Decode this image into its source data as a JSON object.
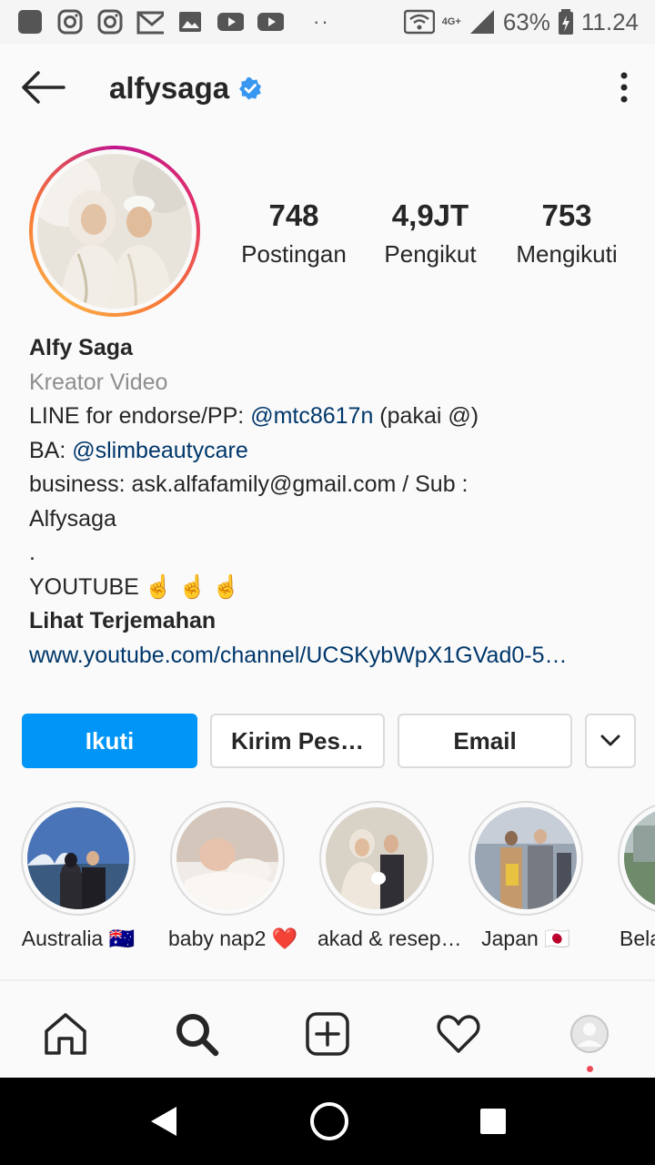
{
  "status_bar": {
    "network": "4G+",
    "battery": "63%",
    "time": "11.24",
    "dots": "··",
    "notification_icons": [
      "square-icon",
      "instagram-icon",
      "instagram-icon",
      "gmail-icon",
      "image-icon",
      "youtube-icon",
      "youtube-icon"
    ]
  },
  "header": {
    "username": "alfysaga",
    "verified": true
  },
  "profile": {
    "stats": [
      {
        "value": "748",
        "label": "Postingan"
      },
      {
        "value": "4,9JT",
        "label": "Pengikut"
      },
      {
        "value": "753",
        "label": "Mengikuti"
      }
    ],
    "name": "Alfy Saga",
    "category": "Kreator Video",
    "bio": {
      "line1_prefix": "LINE for endorse/PP: ",
      "line1_mention": "@mtc8617n",
      "line1_suffix": " (pakai @)",
      "line2_prefix": "BA: ",
      "line2_mention": "@slimbeautycare",
      "line3": "business: ask.alfafamily@gmail.com / Sub :",
      "line4": "Alfysaga",
      "line5": ".",
      "line6": "YOUTUBE",
      "line6_emoji": "☝☝☝",
      "translate": "Lihat Terjemahan",
      "link": "www.youtube.com/channel/UCSKybWpX1GVad0-5…"
    }
  },
  "actions": {
    "follow": "Ikuti",
    "message": "Kirim Pes…",
    "email": "Email"
  },
  "highlights": [
    {
      "label": "Australia 🇦🇺"
    },
    {
      "label": "baby nap2 ❤️"
    },
    {
      "label": "akad & resep…"
    },
    {
      "label": "Japan 🇯🇵"
    },
    {
      "label": "Bela"
    }
  ],
  "colors": {
    "primary_button": "#0095f6",
    "mention": "#00376b",
    "verified": "#3897f0",
    "notification_dot": "#ed4956"
  }
}
